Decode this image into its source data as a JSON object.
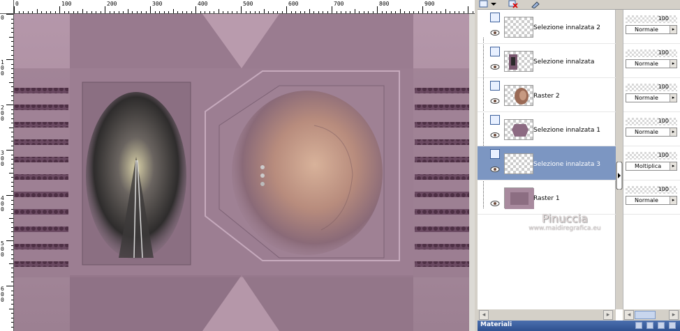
{
  "ruler": {
    "top_labels": [
      "0",
      "100",
      "200",
      "300",
      "400",
      "500",
      "600",
      "700",
      "800",
      "900"
    ],
    "left_labels": [
      "0",
      "100",
      "200",
      "300",
      "400",
      "500",
      "600"
    ]
  },
  "layers_toolbar": {
    "icons": [
      "new-layer-icon",
      "dropdown-icon",
      "delete-layer-icon",
      "mask-icon"
    ]
  },
  "layers": [
    {
      "name": "Selezione innalzata 2",
      "opacity": "100",
      "blend": "Normale",
      "selected": false
    },
    {
      "name": "Selezione innalzata",
      "opacity": "100",
      "blend": "Normale",
      "selected": false
    },
    {
      "name": "Raster 2",
      "opacity": "100",
      "blend": "Normale",
      "selected": false
    },
    {
      "name": "Selezione innalzata 1",
      "opacity": "100",
      "blend": "Normale",
      "selected": false
    },
    {
      "name": "Selezione innalzata 3",
      "opacity": "100",
      "blend": "Moltiplica",
      "selected": true
    },
    {
      "name": "Raster 1",
      "opacity": "100",
      "blend": "Normale",
      "selected": false
    }
  ],
  "watermark": {
    "title": "Pinuccia",
    "url": "www.maidiregrafica.eu"
  },
  "bottom_panel": {
    "title": "Materiali"
  },
  "colors": {
    "canvas_base": "#a88a9e",
    "canvas_dark": "#7e6a78",
    "selection": "#7c96c2",
    "panel_bg": "#d4d0c8",
    "titlebar": "#2e5190"
  }
}
